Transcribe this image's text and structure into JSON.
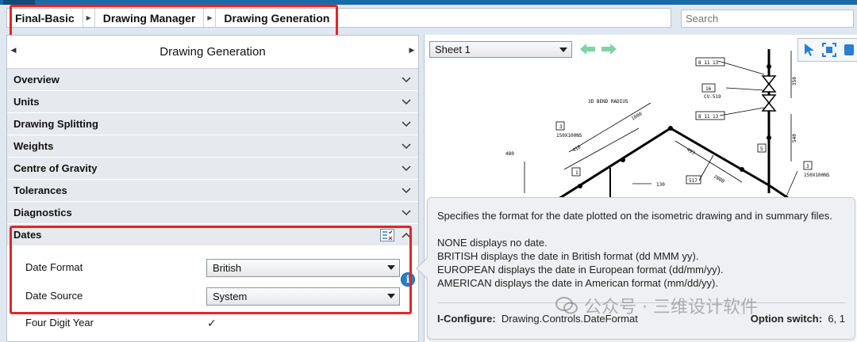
{
  "breadcrumb": {
    "items": [
      "Final-Basic",
      "Drawing Manager",
      "Drawing Generation"
    ]
  },
  "search": {
    "placeholder": "Search"
  },
  "left_panel": {
    "title": "Drawing Generation",
    "sections": [
      {
        "label": "Overview"
      },
      {
        "label": "Units"
      },
      {
        "label": "Drawing Splitting"
      },
      {
        "label": "Weights"
      },
      {
        "label": "Centre of Gravity"
      },
      {
        "label": "Tolerances"
      },
      {
        "label": "Diagnostics"
      }
    ],
    "dates": {
      "label": "Dates",
      "date_format": {
        "label": "Date Format",
        "value": "British"
      },
      "date_source": {
        "label": "Date Source",
        "value": "System"
      },
      "four_digit_year": {
        "label": "Four Digit Year",
        "checked": true,
        "mark": "✓"
      }
    }
  },
  "drawing": {
    "sheet_value": "Sheet 1",
    "labels": {
      "bend": "3D BEND RADIUS",
      "l1": "8 11 13",
      "l2": "16",
      "l3": "CV-519",
      "l4": "8 11 13",
      "l5": "150X100NS",
      "l6": "150X100NS",
      "d1": "1000",
      "d2": "480",
      "d3": "130",
      "d4": "410",
      "d5": "493",
      "d6": "517",
      "d7": "2000",
      "d8": "350",
      "d9": "540",
      "n3": "3",
      "n1": "1",
      "n5": "5",
      "n3b": "3"
    }
  },
  "tooltip": {
    "lines": [
      "Specifies the format for the date plotted on the isometric drawing and in summary files.",
      "NONE displays no date.",
      "BRITISH displays the date in British format (dd MMM yy).",
      "EUROPEAN displays the date in European format (dd/mm/yy).",
      "AMERICAN displays the date in American format (mm/dd/yy)."
    ],
    "configure_label": "I-Configure:",
    "configure_value": "Drawing.Controls.DateFormat",
    "option_label": "Option switch:",
    "option_value": "6, 1"
  },
  "watermark": {
    "text": "公众号 · 三维设计软件"
  },
  "colors": {
    "highlight": "#e3242b",
    "accent": "#2a7fd0",
    "nav_arrow": "#7fd3a6"
  }
}
